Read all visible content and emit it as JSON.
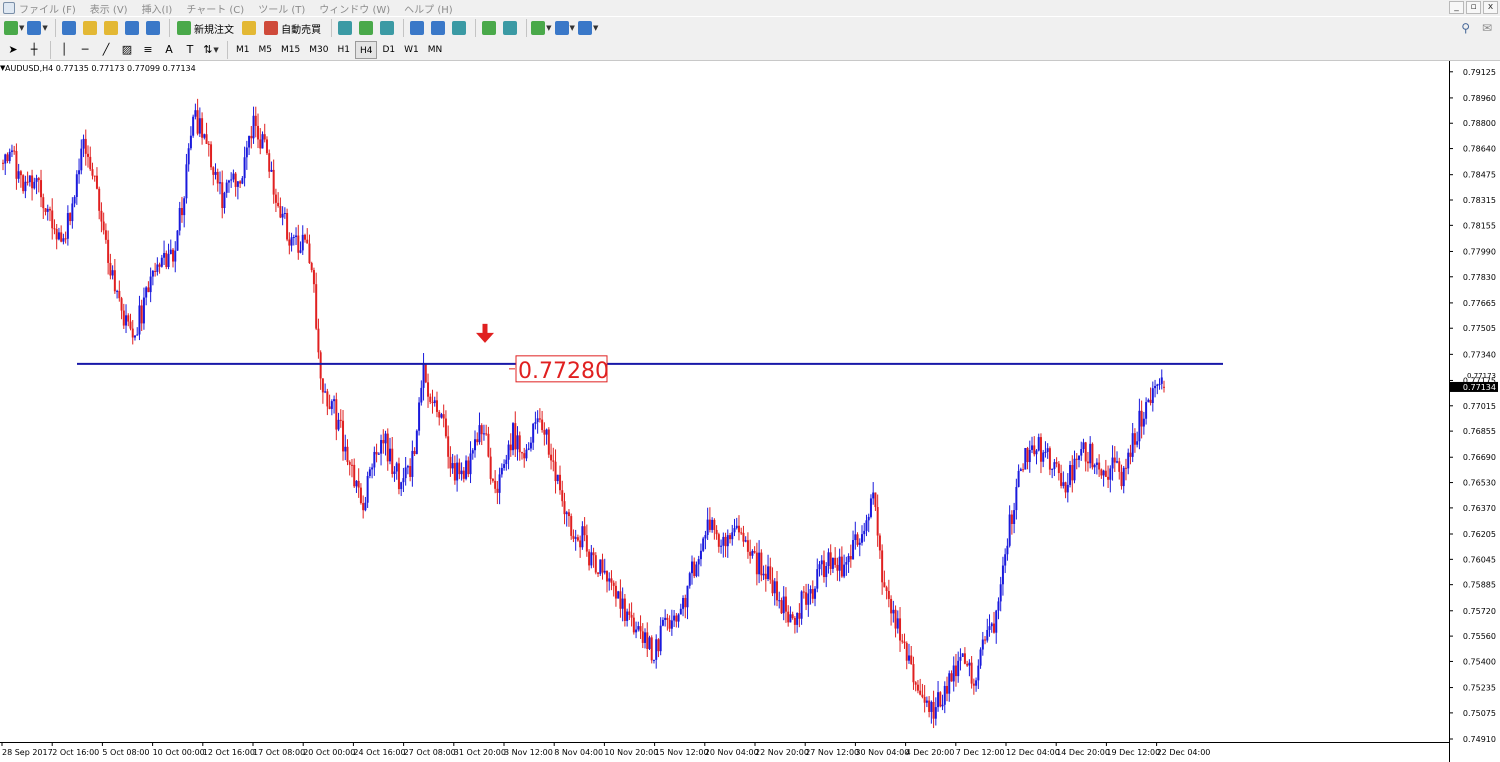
{
  "menu": {
    "items": [
      "ファイル (F)",
      "表示 (V)",
      "挿入(I)",
      "チャート (C)",
      "ツール (T)",
      "ウィンドウ (W)",
      "ヘルプ (H)"
    ]
  },
  "window_controls": [
    "_",
    "▫",
    "x"
  ],
  "toolbar1": {
    "new_order_label": "新規注文",
    "auto_trade_label": "自動売買"
  },
  "toolbar2": {
    "timeframes": [
      "M1",
      "M5",
      "M15",
      "M30",
      "H1",
      "H4",
      "D1",
      "W1",
      "MN"
    ],
    "active_timeframe": "H4",
    "text_tool_label": "A",
    "text_label_tool_label": "T"
  },
  "chart": {
    "header": "AUDUSD,H4  0.77135 0.77173 0.77099 0.77134",
    "current_price_label": "0.77134",
    "current_price_upper_label": "0.77173",
    "annotation_price_text": "0.77280",
    "colors": {
      "bull": "#1a1adc",
      "bear": "#e02020",
      "line": "#1818a8",
      "annotation": "#e02020",
      "price_tag_bg": "#000000"
    }
  },
  "chart_data": {
    "type": "candlestick",
    "symbol": "AUDUSD",
    "timeframe": "H4",
    "ylim": [
      0.7491,
      0.7913
    ],
    "y_ticks": [
      "0.79125",
      "0.78960",
      "0.78800",
      "0.78640",
      "0.78475",
      "0.78315",
      "0.78155",
      "0.77990",
      "0.77830",
      "0.77665",
      "0.77505",
      "0.77340",
      "0.77175",
      "0.77015",
      "0.76855",
      "0.76690",
      "0.76530",
      "0.76370",
      "0.76205",
      "0.76045",
      "0.75885",
      "0.75720",
      "0.75560",
      "0.75400",
      "0.75235",
      "0.75075",
      "0.74910"
    ],
    "x_ticks": [
      "28 Sep 2017",
      "2 Oct 16:00",
      "5 Oct 08:00",
      "10 Oct 00:00",
      "12 Oct 16:00",
      "17 Oct 08:00",
      "20 Oct 00:00",
      "24 Oct 16:00",
      "27 Oct 08:00",
      "31 Oct 20:00",
      "3 Nov 12:00",
      "8 Nov 04:00",
      "10 Nov 20:00",
      "15 Nov 12:00",
      "20 Nov 04:00",
      "22 Nov 20:00",
      "27 Nov 12:00",
      "30 Nov 04:00",
      "4 Dec 20:00",
      "7 Dec 12:00",
      "12 Dec 04:00",
      "14 Dec 20:00",
      "19 Dec 12:00",
      "22 Dec 04:00"
    ],
    "horizontal_line": 0.7728,
    "last": {
      "open": 0.77135,
      "high": 0.77173,
      "low": 0.77099,
      "close": 0.77134
    },
    "path": [
      0.7855,
      0.7858,
      0.7835,
      0.7848,
      0.7832,
      0.7815,
      0.7808,
      0.783,
      0.7868,
      0.785,
      0.7815,
      0.778,
      0.7758,
      0.7748,
      0.7762,
      0.779,
      0.7795,
      0.78,
      0.783,
      0.7888,
      0.7872,
      0.7852,
      0.7832,
      0.784,
      0.785,
      0.7878,
      0.7868,
      0.784,
      0.782,
      0.78,
      0.781,
      0.778,
      0.7705,
      0.77,
      0.768,
      0.766,
      0.764,
      0.7668,
      0.7682,
      0.766,
      0.7652,
      0.767,
      0.7722,
      0.7705,
      0.769,
      0.766,
      0.7655,
      0.7672,
      0.769,
      0.7645,
      0.766,
      0.7685,
      0.7665,
      0.7683,
      0.769,
      0.766,
      0.7638,
      0.762,
      0.7618,
      0.76,
      0.7598,
      0.759,
      0.757,
      0.756,
      0.7555,
      0.7545,
      0.756,
      0.7568,
      0.7575,
      0.76,
      0.762,
      0.7625,
      0.7612,
      0.762,
      0.7615,
      0.7605,
      0.7598,
      0.759,
      0.7575,
      0.7565,
      0.758,
      0.7588,
      0.76,
      0.7605,
      0.7598,
      0.7612,
      0.7625,
      0.7645,
      0.758,
      0.757,
      0.7545,
      0.753,
      0.7512,
      0.7508,
      0.752,
      0.753,
      0.754,
      0.753,
      0.7555,
      0.7565,
      0.761,
      0.764,
      0.767,
      0.7678,
      0.7672,
      0.766,
      0.765,
      0.7662,
      0.7672,
      0.767,
      0.766,
      0.7665,
      0.7655,
      0.768,
      0.77,
      0.7712,
      0.7713
    ]
  }
}
